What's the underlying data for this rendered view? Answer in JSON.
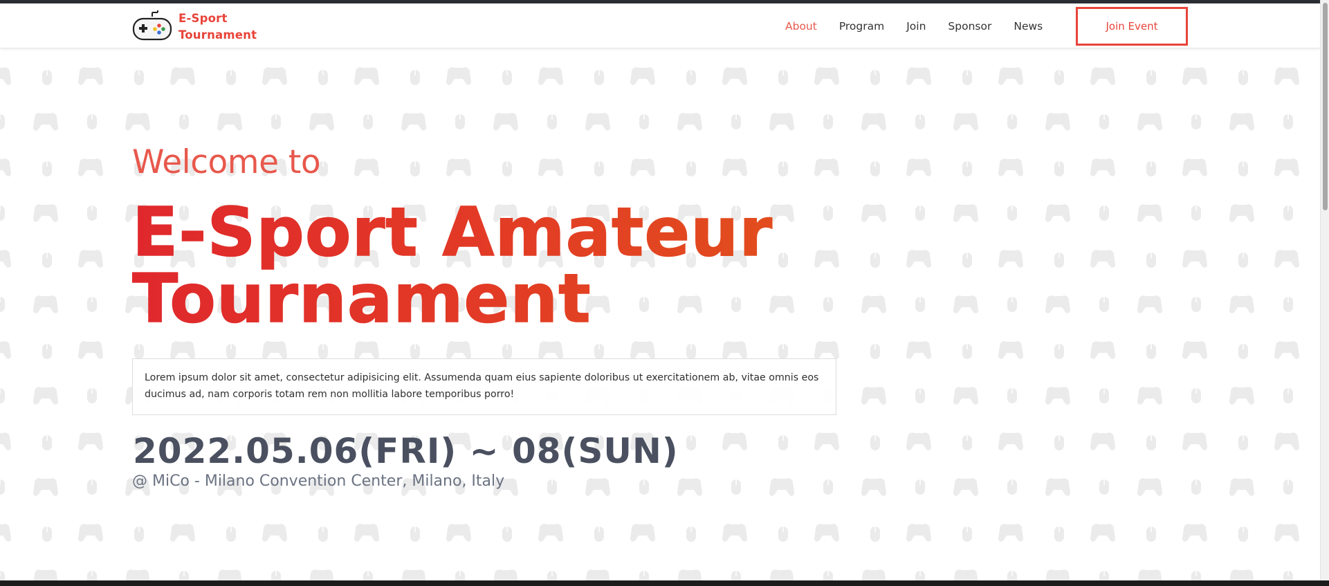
{
  "brand": {
    "line1": "E-Sport",
    "line2": "Tournament",
    "logo_icon": "gamepad-icon",
    "color": "#e8443a"
  },
  "nav": {
    "items": [
      {
        "label": "About",
        "active": true
      },
      {
        "label": "Program",
        "active": false
      },
      {
        "label": "Join",
        "active": false
      },
      {
        "label": "Sponsor",
        "active": false
      },
      {
        "label": "News",
        "active": false
      }
    ],
    "cta_label": "Join Event"
  },
  "hero": {
    "welcome": "Welcome to",
    "title_line1": "E-Sport Amateur",
    "title_line2": "Tournament",
    "description": "Lorem ipsum dolor sit amet, consectetur adipisicing elit. Assumenda quam eius sapiente doloribus ut exercitationem ab, vitae omnis eos ducimus ad, nam corporis totam rem non mollitia labore temporibus porro!",
    "date": "2022.05.06(FRI) ~ 08(SUN)",
    "venue": "@ MiCo - Milano Convention Center, Milano, Italy"
  },
  "background": {
    "pattern_icons": [
      "gamepad-icon",
      "mouse-icon"
    ],
    "pattern_color": "#ececec"
  },
  "colors": {
    "accent": "#e8443a",
    "title_gradient_start": "#e0282c",
    "title_gradient_end": "#e2541a",
    "date_text": "#4a5060"
  }
}
